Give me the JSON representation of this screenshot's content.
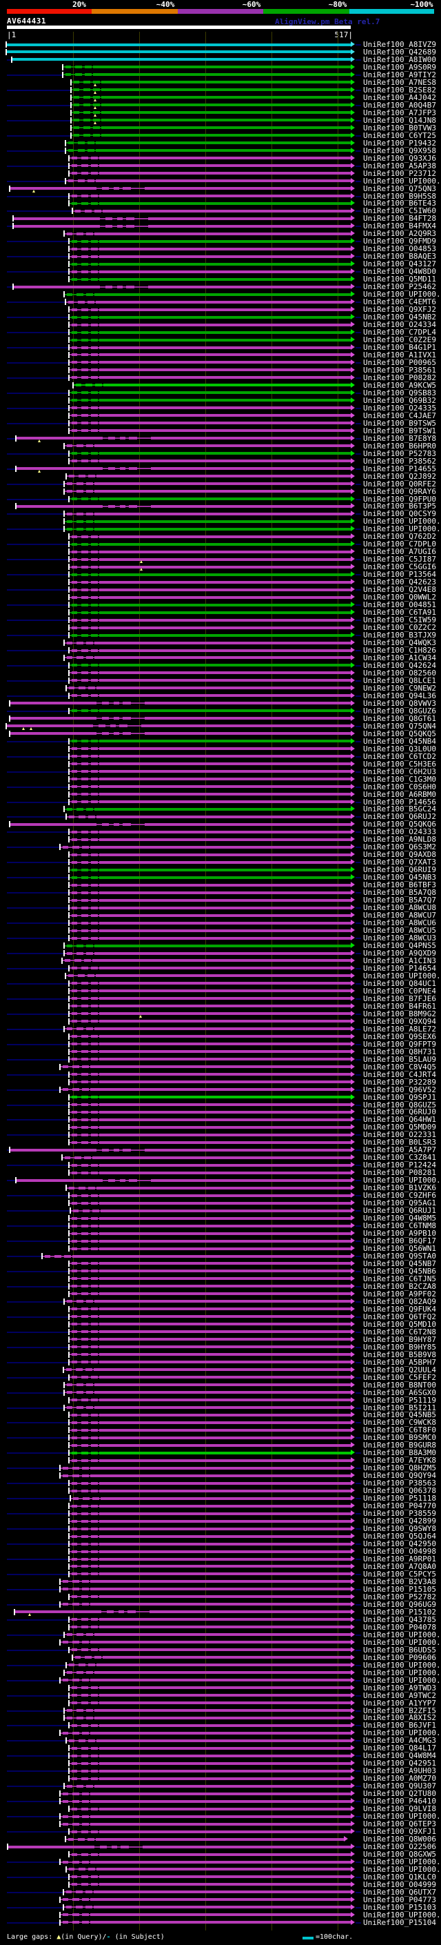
{
  "header": {
    "title": "AV644431",
    "credit": "AlignView.pm Beta rel.7",
    "query_start": "|1",
    "query_end": "517|",
    "query_length": 517
  },
  "scale": {
    "labels": [
      "20%",
      "~40%",
      "~60%",
      "~80%",
      "~100%"
    ],
    "colors": [
      "#ee1100",
      "#dd7700",
      "#9932ad",
      "#00a400",
      "#00c4ce"
    ]
  },
  "legend": {
    "prefix": "Large gaps: ",
    "gap_query_symbol": "▲",
    "gap_query_text": "(in Query)/",
    "gap_subject_symbol": "-",
    "gap_subject_text": " (in Subject)",
    "scale_note": "=100char."
  },
  "colors": {
    "background": "#000000",
    "cyan": "#00c4ce",
    "green": "#008f00",
    "green_thick": "#00a400",
    "bright_green": "#00c400",
    "magenta": "#a02fa0",
    "magenta_thick": "#b73ab7",
    "leader_navy": "#000060",
    "gridline_olive": "#3b3b00",
    "gap_marker_yellow": "#ffff8c",
    "credit_blue": "#2525a8",
    "label_white": "#f2f2f2"
  },
  "chart_data": {
    "type": "alignment-hit-map",
    "title": "AV644431",
    "x_axis": {
      "start": 1,
      "end": 517,
      "tick_interval_chars": 100,
      "note": "=100char."
    },
    "identity_scale": [
      {
        "label": "20%",
        "color": "#ee1100"
      },
      {
        "label": "~40%",
        "color": "#dd7700"
      },
      {
        "label": "~60%",
        "color": "#9932ad"
      },
      {
        "label": "~80%",
        "color": "#00a400"
      },
      {
        "label": "~100%",
        "color": "#00c4ce"
      }
    ],
    "rows": [
      [
        "UniRef100_A8IVZ9",
        "c",
        10
      ],
      [
        "UniRef100_Q42689",
        "c",
        10
      ],
      [
        "UniRef100_A8IW00",
        "c",
        18
      ],
      [
        "UniRef100_A9S0R9",
        "g",
        92
      ],
      [
        "UniRef100_A9TIY2",
        "g",
        92
      ],
      [
        "UniRef100_A7NES8",
        "g",
        104,
        509,
        [
          136
        ]
      ],
      [
        "UniRef100_B2SE82",
        "g",
        104,
        509,
        [
          136
        ]
      ],
      [
        "UniRef100_A4J042",
        "g",
        104,
        509,
        [
          136
        ]
      ],
      [
        "UniRef100_A0Q4B7",
        "g",
        104,
        509,
        [
          136
        ]
      ],
      [
        "UniRef100_A7JFP3",
        "g",
        104,
        509,
        [
          136
        ]
      ],
      [
        "UniRef100_Q14JN8",
        "g",
        104,
        509,
        [
          136
        ]
      ],
      [
        "UniRef100_B0TVW3",
        "g",
        104
      ],
      [
        "UniRef100_C6YT25",
        "g",
        104
      ],
      [
        "UniRef100_P19432",
        "g",
        96
      ],
      [
        "UniRef100_Q9X958",
        "g",
        96
      ],
      [
        "UniRef100_Q93XJ6",
        "m",
        101
      ],
      [
        "UniRef100_A5AP38",
        "m",
        101
      ],
      [
        "UniRef100_P23712",
        "m",
        101
      ],
      [
        "UniRef100_UPI000..",
        "m",
        96
      ],
      [
        "UniRef100_Q75QN3",
        "m",
        15,
        509,
        [
          47
        ]
      ],
      [
        "UniRef100_B9H5S8",
        "m",
        101
      ],
      [
        "UniRef100_B6TE43",
        "g",
        101
      ],
      [
        "UniRef100_C5IW60",
        "m",
        106
      ],
      [
        "UniRef100_B4FT28",
        "m",
        20
      ],
      [
        "UniRef100_B4FMX4",
        "m",
        20
      ],
      [
        "UniRef100_A2Q9R3",
        "m",
        94
      ],
      [
        "UniRef100_Q9FMD9",
        "g",
        101
      ],
      [
        "UniRef100_O04853",
        "m",
        101
      ],
      [
        "UniRef100_B8AQE3",
        "m",
        101
      ],
      [
        "UniRef100_Q43127",
        "g",
        101
      ],
      [
        "UniRef100_Q4W8D0",
        "m",
        101
      ],
      [
        "UniRef100_Q5MD11",
        "g",
        101
      ],
      [
        "UniRef100_P25462",
        "m",
        20
      ],
      [
        "UniRef100_UPI000..",
        "g",
        94
      ],
      [
        "UniRef100_C4EMT6",
        "m",
        96
      ],
      [
        "UniRef100_Q9XFJ2",
        "m",
        101
      ],
      [
        "UniRef100_Q45NB2",
        "g",
        101
      ],
      [
        "UniRef100_O24334",
        "m",
        101
      ],
      [
        "UniRef100_C7DPL4",
        "g",
        101
      ],
      [
        "UniRef100_C0Z2E9",
        "g",
        101
      ],
      [
        "UniRef100_B4G1P1",
        "m",
        101
      ],
      [
        "UniRef100_A1IVX1",
        "m",
        101
      ],
      [
        "UniRef100_P00965",
        "m",
        101
      ],
      [
        "UniRef100_P38561",
        "m",
        101
      ],
      [
        "UniRef100_P08282",
        "m",
        101
      ],
      [
        "UniRef100_A9KCW5",
        "G",
        107
      ],
      [
        "UniRef100_Q9SB83",
        "g",
        101
      ],
      [
        "UniRef100_Q69B32",
        "g",
        101
      ],
      [
        "UniRef100_O24335",
        "m",
        101
      ],
      [
        "UniRef100_C4JAE7",
        "m",
        101
      ],
      [
        "UniRef100_B9TSW5",
        "m",
        101
      ],
      [
        "UniRef100_B9TSW1",
        "m",
        101
      ],
      [
        "UniRef100_B7E8Y8",
        "m",
        24,
        509,
        [
          55
        ]
      ],
      [
        "UniRef100_B6HPR0",
        "m",
        94
      ],
      [
        "UniRef100_P52783",
        "g",
        101
      ],
      [
        "UniRef100_P38562",
        "m",
        101
      ],
      [
        "UniRef100_P14655",
        "m",
        24,
        509,
        [
          55
        ]
      ],
      [
        "UniRef100_Q2J892",
        "m",
        97
      ],
      [
        "UniRef100_Q0RFE2",
        "m",
        94
      ],
      [
        "UniRef100_Q9RAY6",
        "m",
        94
      ],
      [
        "UniRef100_Q9FPU0",
        "g",
        101
      ],
      [
        "UniRef100_B6T3P5",
        "m",
        24
      ],
      [
        "UniRef100_Q0CSY9",
        "m",
        94
      ],
      [
        "UniRef100_UPI000..",
        "g",
        94
      ],
      [
        "UniRef100_UPI000..",
        "g",
        94
      ],
      [
        "UniRef100_Q762D2",
        "m",
        101
      ],
      [
        "UniRef100_C7DPL0",
        "g",
        101
      ],
      [
        "UniRef100_A7UGI6",
        "m",
        101
      ],
      [
        "UniRef100_C5JI87",
        "m",
        101,
        509,
        [
          203
        ]
      ],
      [
        "UniRef100_C5GGI6",
        "m",
        101,
        509,
        [
          203
        ]
      ],
      [
        "UniRef100_P13564",
        "g",
        101
      ],
      [
        "UniRef100_Q42623",
        "m",
        101
      ],
      [
        "UniRef100_Q2V4E8",
        "m",
        101
      ],
      [
        "UniRef100_Q0WWL2",
        "m",
        101
      ],
      [
        "UniRef100_O04851",
        "g",
        101
      ],
      [
        "UniRef100_C6TA91",
        "g",
        101
      ],
      [
        "UniRef100_C5IW59",
        "m",
        101
      ],
      [
        "UniRef100_C0Z2C2",
        "m",
        101
      ],
      [
        "UniRef100_B3TJX9",
        "g",
        101
      ],
      [
        "UniRef100_Q4WQK3",
        "m",
        94
      ],
      [
        "UniRef100_C1H826",
        "m",
        101
      ],
      [
        "UniRef100_A1CW34",
        "m",
        94
      ],
      [
        "UniRef100_Q42624",
        "g",
        101
      ],
      [
        "UniRef100_O82560",
        "m",
        101
      ],
      [
        "UniRef100_Q8LCE1",
        "m",
        101
      ],
      [
        "UniRef100_C9NEW2",
        "m",
        97
      ],
      [
        "UniRef100_Q94L36",
        "m",
        101
      ],
      [
        "UniRef100_Q8VWV3",
        "m",
        15
      ],
      [
        "UniRef100_Q8GUZ6",
        "g",
        101
      ],
      [
        "UniRef100_Q8GT61",
        "m",
        15
      ],
      [
        "UniRef100_Q75QN4",
        "m",
        10,
        509,
        [
          32,
          43
        ]
      ],
      [
        "UniRef100_Q5QKQ5",
        "m",
        15
      ],
      [
        "UniRef100_Q45NB4",
        "g",
        101
      ],
      [
        "UniRef100_Q3L0U0",
        "m",
        101
      ],
      [
        "UniRef100_C6TCD2",
        "m",
        101
      ],
      [
        "UniRef100_C5H3E6",
        "m",
        101
      ],
      [
        "UniRef100_C6H2U3",
        "m",
        101
      ],
      [
        "UniRef100_C1G3M0",
        "m",
        101
      ],
      [
        "UniRef100_C0S6H0",
        "m",
        101
      ],
      [
        "UniRef100_A6RBM0",
        "m",
        101
      ],
      [
        "UniRef100_P14656",
        "m",
        101
      ],
      [
        "UniRef100_B5GC24",
        "g",
        94
      ],
      [
        "UniRef100_Q6RUJ2",
        "m",
        97
      ],
      [
        "UniRef100_Q5QKQ6",
        "m",
        15
      ],
      [
        "UniRef100_O24333",
        "m",
        101
      ],
      [
        "UniRef100_A9NLD8",
        "m",
        101
      ],
      [
        "UniRef100_Q6S3M2",
        "m",
        88
      ],
      [
        "UniRef100_Q9AXD8",
        "m",
        101
      ],
      [
        "UniRef100_Q7XAT3",
        "m",
        101
      ],
      [
        "UniRef100_Q6RUI9",
        "g",
        101
      ],
      [
        "UniRef100_Q45NB3",
        "g",
        101
      ],
      [
        "UniRef100_B6TBF3",
        "m",
        101
      ],
      [
        "UniRef100_B5A7Q8",
        "m",
        101
      ],
      [
        "UniRef100_B5A7Q7",
        "m",
        101
      ],
      [
        "UniRef100_A8WCU8",
        "m",
        101
      ],
      [
        "UniRef100_A8WCU7",
        "m",
        101
      ],
      [
        "UniRef100_A8WCU6",
        "m",
        101
      ],
      [
        "UniRef100_A8WCU5",
        "m",
        101
      ],
      [
        "UniRef100_A8WCU3",
        "m",
        101
      ],
      [
        "UniRef100_Q4PNS5",
        "g",
        94
      ],
      [
        "UniRef100_A9QXD9",
        "m",
        94
      ],
      [
        "UniRef100_A1CIN3",
        "m",
        91
      ],
      [
        "UniRef100_P14654",
        "m",
        101
      ],
      [
        "UniRef100_UPI000..",
        "m",
        96
      ],
      [
        "UniRef100_Q84UC1",
        "m",
        101
      ],
      [
        "UniRef100_C0PNE4",
        "m",
        101
      ],
      [
        "UniRef100_B7FJE6",
        "m",
        101
      ],
      [
        "UniRef100_B4FR61",
        "m",
        101
      ],
      [
        "UniRef100_B8M9G2",
        "m",
        101,
        509,
        [
          202
        ]
      ],
      [
        "UniRef100_Q9XQ94",
        "m",
        101
      ],
      [
        "UniRef100_A8LE72",
        "m",
        94
      ],
      [
        "UniRef100_Q9SEX6",
        "m",
        101
      ],
      [
        "UniRef100_Q9FPT9",
        "m",
        101
      ],
      [
        "UniRef100_Q8H731",
        "m",
        101
      ],
      [
        "UniRef100_B5LAU9",
        "m",
        101
      ],
      [
        "UniRef100_C8V4Q5",
        "m",
        88
      ],
      [
        "UniRef100_C4JRT4",
        "m",
        101
      ],
      [
        "UniRef100_P32289",
        "m",
        101
      ],
      [
        "UniRef100_Q96V52",
        "m",
        88
      ],
      [
        "UniRef100_Q9SPJ1",
        "G",
        101
      ],
      [
        "UniRef100_Q8GUZ5",
        "m",
        101
      ],
      [
        "UniRef100_Q6RUJ0",
        "m",
        101
      ],
      [
        "UniRef100_Q64HW1",
        "m",
        101
      ],
      [
        "UniRef100_Q5MD09",
        "m",
        101
      ],
      [
        "UniRef100_O22331",
        "m",
        101
      ],
      [
        "UniRef100_B0LSR3",
        "m",
        101
      ],
      [
        "UniRef100_A5A7P7",
        "m",
        15
      ],
      [
        "UniRef100_C3Z841",
        "m",
        91
      ],
      [
        "UniRef100_P12424",
        "m",
        101
      ],
      [
        "UniRef100_P08281",
        "m",
        101
      ],
      [
        "UniRef100_UPI000..",
        "m",
        24
      ],
      [
        "UniRef100_B1VZK6",
        "m",
        97
      ],
      [
        "UniRef100_C9ZHF6",
        "m",
        101
      ],
      [
        "UniRef100_Q95AG1",
        "m",
        101
      ],
      [
        "UniRef100_Q6RUJ1",
        "m",
        103
      ],
      [
        "UniRef100_Q4W8M5",
        "m",
        101
      ],
      [
        "UniRef100_C6TNM8",
        "m",
        101
      ],
      [
        "UniRef100_A9PB10",
        "m",
        101
      ],
      [
        "UniRef100_B6QF17",
        "m",
        101
      ],
      [
        "UniRef100_Q56WN1",
        "m",
        101
      ],
      [
        "UniRef100_Q9STA0",
        "m",
        62
      ],
      [
        "UniRef100_Q45NB7",
        "m",
        101
      ],
      [
        "UniRef100_Q45NB6",
        "m",
        101
      ],
      [
        "UniRef100_C6TJN5",
        "m",
        101
      ],
      [
        "UniRef100_B2CZA8",
        "m",
        101
      ],
      [
        "UniRef100_A9PF02",
        "m",
        101
      ],
      [
        "UniRef100_Q82AQ9",
        "m",
        94
      ],
      [
        "UniRef100_Q9FUK4",
        "m",
        101
      ],
      [
        "UniRef100_Q6TFQ2",
        "m",
        101
      ],
      [
        "UniRef100_Q5MD10",
        "m",
        101
      ],
      [
        "UniRef100_C6T2N8",
        "m",
        101
      ],
      [
        "UniRef100_B9HY87",
        "m",
        101
      ],
      [
        "UniRef100_B9HY85",
        "m",
        101
      ],
      [
        "UniRef100_B5B9V8",
        "m",
        101
      ],
      [
        "UniRef100_A5BPH7",
        "m",
        101
      ],
      [
        "UniRef100_Q2UUL4",
        "m",
        93
      ],
      [
        "UniRef100_C5FEF2",
        "m",
        101
      ],
      [
        "UniRef100_B8NT00",
        "m",
        94
      ],
      [
        "UniRef100_A6SGX0",
        "m",
        94
      ],
      [
        "UniRef100_P51119",
        "m",
        101
      ],
      [
        "UniRef100_B5I211",
        "m",
        94
      ],
      [
        "UniRef100_Q45NB5",
        "m",
        101
      ],
      [
        "UniRef100_C9WCK8",
        "m",
        101
      ],
      [
        "UniRef100_C6T8F0",
        "m",
        101
      ],
      [
        "UniRef100_B9SMC0",
        "m",
        101
      ],
      [
        "UniRef100_B9GUR8",
        "m",
        101
      ],
      [
        "UniRef100_B8A3M0",
        "G",
        101
      ],
      [
        "UniRef100_A7EYK8",
        "m",
        101
      ],
      [
        "UniRef100_Q8HZM5",
        "m",
        88
      ],
      [
        "UniRef100_Q9QY94",
        "m",
        88
      ],
      [
        "UniRef100_P38563",
        "m",
        101
      ],
      [
        "UniRef100_Q06378",
        "m",
        101
      ],
      [
        "UniRef100_P51118",
        "m",
        103
      ],
      [
        "UniRef100_P04770",
        "m",
        101
      ],
      [
        "UniRef100_P38559",
        "m",
        101
      ],
      [
        "UniRef100_Q42899",
        "m",
        101
      ],
      [
        "UniRef100_Q9SWY8",
        "m",
        101
      ],
      [
        "UniRef100_Q5QJ64",
        "m",
        101
      ],
      [
        "UniRef100_Q42950",
        "m",
        101
      ],
      [
        "UniRef100_O04998",
        "m",
        101
      ],
      [
        "UniRef100_A9RP01",
        "m",
        101
      ],
      [
        "UniRef100_A7Q8A0",
        "m",
        101
      ],
      [
        "UniRef100_C5PCY5",
        "m",
        101
      ],
      [
        "UniRef100_B2V3A8",
        "m",
        88
      ],
      [
        "UniRef100_P15105",
        "m",
        88
      ],
      [
        "UniRef100_P52782",
        "m",
        101
      ],
      [
        "UniRef100_Q96UG9",
        "m",
        88
      ],
      [
        "UniRef100_P15102",
        "m",
        22,
        509,
        [
          41
        ]
      ],
      [
        "UniRef100_Q43785",
        "m",
        101
      ],
      [
        "UniRef100_P04078",
        "m",
        101
      ],
      [
        "UniRef100_UPI000..",
        "m",
        94
      ],
      [
        "UniRef100_UPI000..",
        "m",
        88
      ],
      [
        "UniRef100_B6UDS5",
        "m",
        101
      ],
      [
        "UniRef100_P09606",
        "m",
        106
      ],
      [
        "UniRef100_UPI000..",
        "m",
        97
      ],
      [
        "UniRef100_UPI000..",
        "m",
        94
      ],
      [
        "UniRef100_UPI000..",
        "m",
        88
      ],
      [
        "UniRef100_A9TWD3",
        "m",
        101
      ],
      [
        "UniRef100_A9TWC2",
        "m",
        101
      ],
      [
        "UniRef100_A1YYP7",
        "m",
        101
      ],
      [
        "UniRef100_B2ZFI5",
        "m",
        94
      ],
      [
        "UniRef100_A8XIS2",
        "m",
        94
      ],
      [
        "UniRef100_B6JVF1",
        "m",
        101
      ],
      [
        "UniRef100_UPI000..",
        "m",
        88
      ],
      [
        "UniRef100_A4CMG3",
        "m",
        97
      ],
      [
        "UniRef100_Q84L17",
        "m",
        101
      ],
      [
        "UniRef100_Q4W8M4",
        "m",
        101
      ],
      [
        "UniRef100_Q42951",
        "m",
        101
      ],
      [
        "UniRef100_A9UH03",
        "m",
        101
      ],
      [
        "UniRef100_A0MZ70",
        "m",
        101
      ],
      [
        "UniRef100_Q9U307",
        "m",
        94
      ],
      [
        "UniRef100_Q2TU80",
        "m",
        88
      ],
      [
        "UniRef100_P46410",
        "m",
        88
      ],
      [
        "UniRef100_Q9LVI8",
        "m",
        101
      ],
      [
        "UniRef100_UPI000..",
        "m",
        88
      ],
      [
        "UniRef100_Q6TEP3",
        "m",
        88
      ],
      [
        "UniRef100_Q9XFJ1",
        "m",
        101
      ],
      [
        "UniRef100_Q8W006",
        "m",
        96,
        499
      ],
      [
        "UniRef100_O22506",
        "m",
        12
      ],
      [
        "UniRef100_Q8GXW5",
        "m",
        101
      ],
      [
        "UniRef100_UPI000..",
        "m",
        88
      ],
      [
        "UniRef100_UPI000..",
        "m",
        97
      ],
      [
        "UniRef100_Q1KLC0",
        "m",
        101
      ],
      [
        "UniRef100_O04999",
        "m",
        101
      ],
      [
        "UniRef100_Q6UTX7",
        "m",
        93
      ],
      [
        "UniRef100_P04773",
        "m",
        88
      ],
      [
        "UniRef100_P15103",
        "m",
        93
      ],
      [
        "UniRef100_UPI000..",
        "m",
        88
      ],
      [
        "UniRef100_P15104",
        "m",
        88
      ]
    ]
  }
}
